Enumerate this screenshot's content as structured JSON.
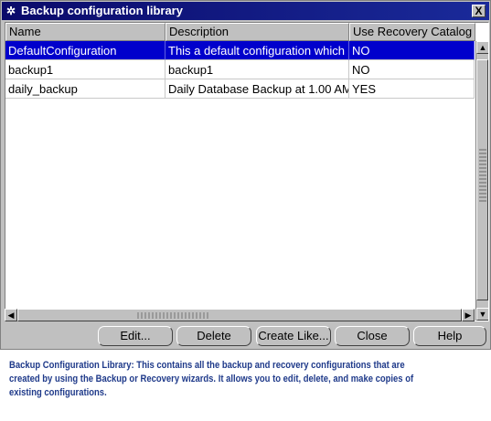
{
  "window": {
    "title": "Backup configuration library",
    "close_label": "X"
  },
  "table": {
    "columns": [
      "Name",
      "Description",
      "Use Recovery Catalog"
    ],
    "rows": [
      {
        "name": "DefaultConfiguration",
        "description": "This a default configuration which backs",
        "use_recovery_catalog": "NO",
        "selected": true
      },
      {
        "name": "backup1",
        "description": "backup1",
        "use_recovery_catalog": "NO",
        "selected": false
      },
      {
        "name": "daily_backup",
        "description": "Daily Database Backup at 1.00 AM",
        "use_recovery_catalog": "YES",
        "selected": false
      }
    ]
  },
  "buttons": {
    "edit": "Edit...",
    "delete": "Delete",
    "create_like": "Create Like...",
    "close": "Close",
    "help": "Help"
  },
  "caption": {
    "lead": "Backup Configuration Library:",
    "text": " This contains all the backup and recovery configurations  that are created by using the Backup or Recovery wizards. It allows you to edit, delete, and make copies of existing configurations."
  },
  "colors": {
    "title_bar": "#0a0a6a",
    "selection": "#0000cc",
    "caption_text": "#1f3a8a",
    "dialog_bg": "#c0c0c0"
  },
  "icons": {
    "window": "oracle-window-icon",
    "close": "close-icon",
    "scroll_up": "arrow-up-icon",
    "scroll_down": "arrow-down-icon",
    "scroll_left": "arrow-left-icon",
    "scroll_right": "arrow-right-icon"
  }
}
